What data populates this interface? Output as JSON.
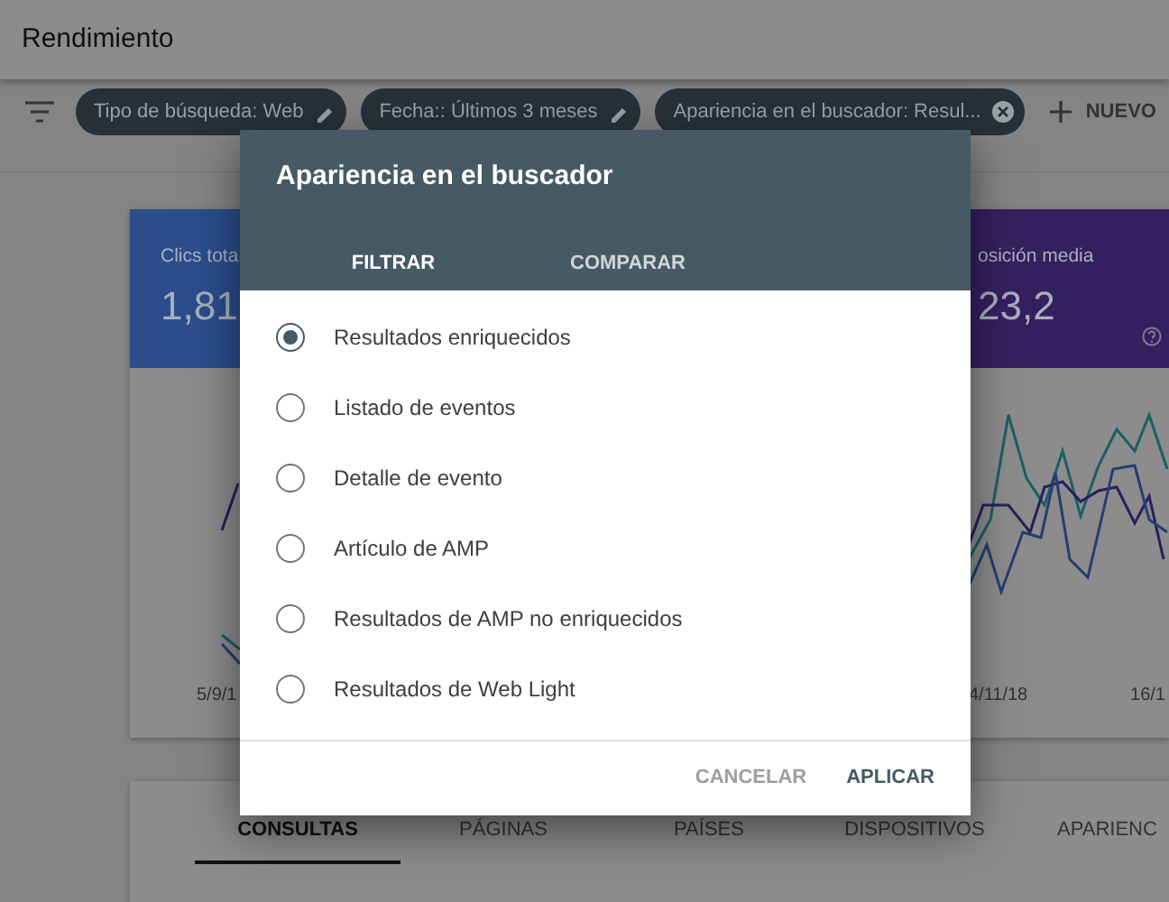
{
  "header": {
    "title": "Rendimiento"
  },
  "filters": [
    {
      "label": "Tipo de búsqueda: Web",
      "kind": "edit"
    },
    {
      "label": "Fecha:: Últimos 3 meses",
      "kind": "edit"
    },
    {
      "label": "Apariencia en el buscador: Resul...",
      "kind": "remove"
    }
  ],
  "new_filter": {
    "label": "NUEVO"
  },
  "metric_cards": [
    {
      "label": "Clics tota",
      "value": "1,81",
      "color": "#2b4d8c"
    },
    {
      "label": "osición media",
      "value": "23,2",
      "color": "#35205f"
    }
  ],
  "chart": {
    "x_labels_left": [
      "5/9/1"
    ],
    "x_labels_right": [
      "4/11/18",
      "16/1"
    ]
  },
  "bottom_tabs": [
    {
      "label": "CONSULTAS",
      "selected": true
    },
    {
      "label": "PÁGINAS",
      "selected": false
    },
    {
      "label": "PAÍSES",
      "selected": false
    },
    {
      "label": "DISPOSITIVOS",
      "selected": false
    },
    {
      "label": "APARIENC",
      "selected": false
    }
  ],
  "dialog": {
    "title": "Apariencia en el buscador",
    "tabs": [
      {
        "label": "FILTRAR",
        "selected": true
      },
      {
        "label": "COMPARAR",
        "selected": false
      }
    ],
    "options": [
      {
        "label": "Resultados enriquecidos",
        "selected": true
      },
      {
        "label": "Listado de eventos",
        "selected": false
      },
      {
        "label": "Detalle de evento",
        "selected": false
      },
      {
        "label": "Artículo de AMP",
        "selected": false
      },
      {
        "label": "Resultados de AMP no enriquecidos",
        "selected": false
      },
      {
        "label": "Resultados de Web Light",
        "selected": false
      }
    ],
    "buttons": [
      {
        "label": "CANCELAR",
        "kind": "secondary"
      },
      {
        "label": "APLICAR",
        "kind": "primary"
      }
    ]
  }
}
